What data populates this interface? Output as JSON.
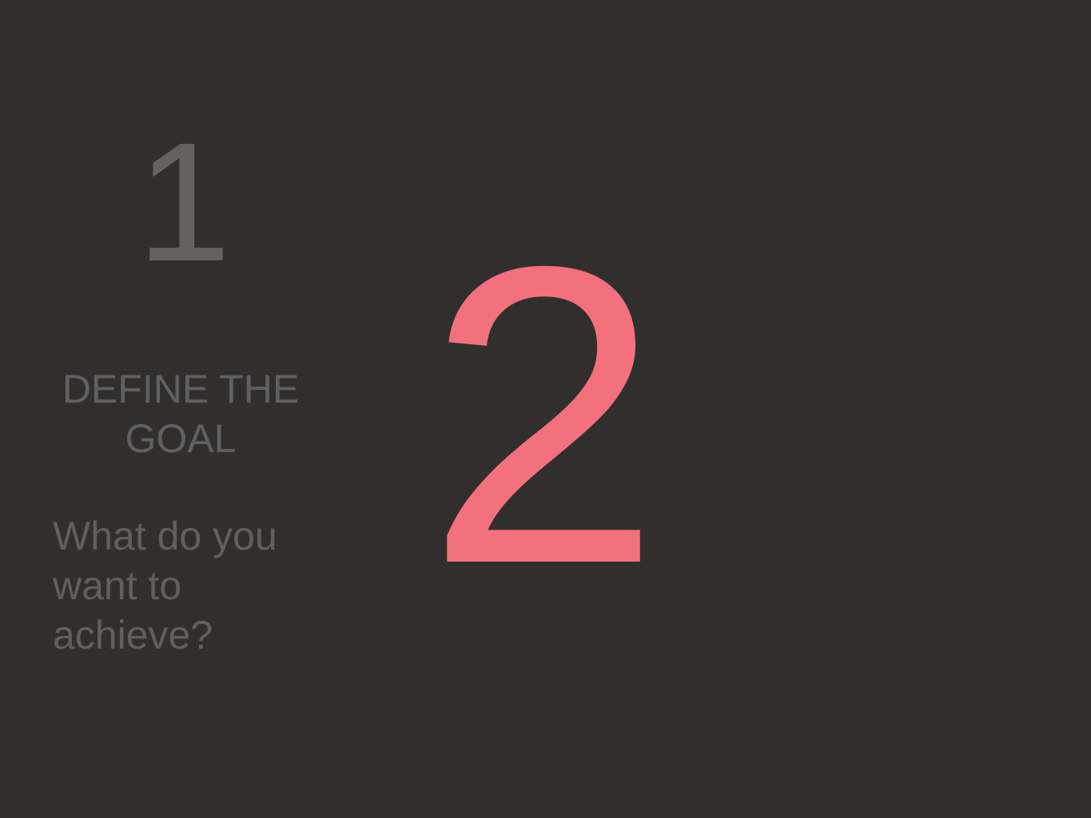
{
  "slide": {
    "secondary_step": {
      "number": "1",
      "title": "DEFINE THE GOAL",
      "question": "What do you want to achieve?"
    },
    "current_step": {
      "number": "2"
    }
  },
  "colors": {
    "background": "#312f2e",
    "muted_text": "#636261",
    "accent": "#f3717c"
  }
}
